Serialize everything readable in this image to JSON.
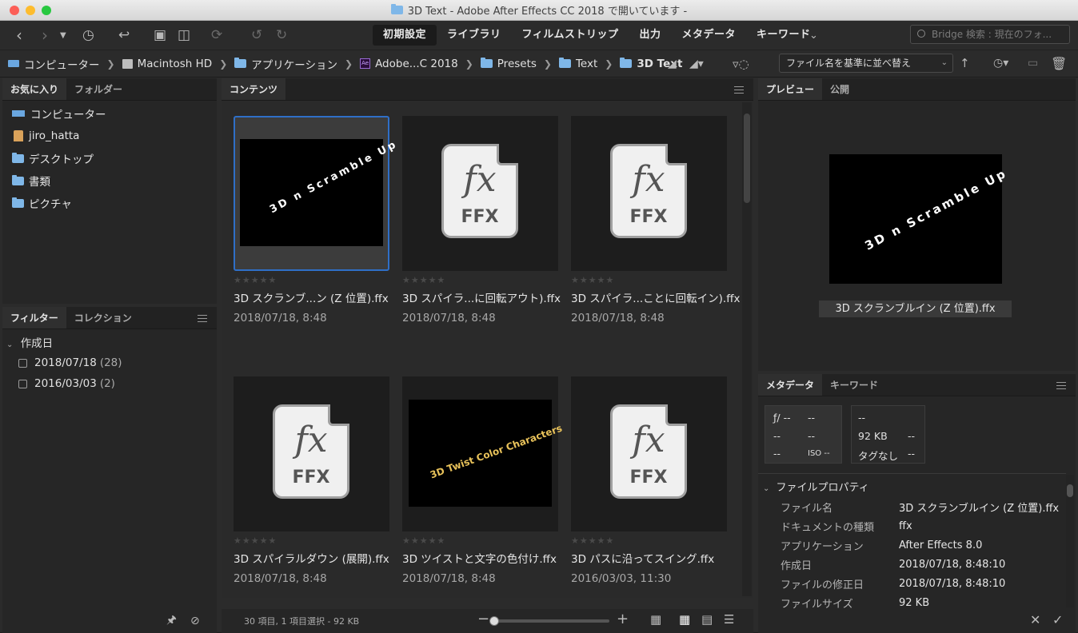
{
  "window": {
    "title": "3D Text - Adobe After Effects CC 2018 で開いています -"
  },
  "workspaces": [
    "初期設定",
    "ライブラリ",
    "フィルムストリップ",
    "出力",
    "メタデータ",
    "キーワード"
  ],
  "search": {
    "placeholder": "Bridge 検索 : 現在のフォ..."
  },
  "breadcrumb": [
    {
      "label": "コンピューター",
      "icon": "computer-icon"
    },
    {
      "label": "Macintosh HD",
      "icon": "disk-icon"
    },
    {
      "label": "アプリケーション",
      "icon": "folder-icon"
    },
    {
      "label": "Adobe...C 2018",
      "icon": "ae-icon"
    },
    {
      "label": "Presets",
      "icon": "folder-icon"
    },
    {
      "label": "Text",
      "icon": "folder-icon"
    },
    {
      "label": "3D Text",
      "icon": "folder-icon"
    }
  ],
  "sort": {
    "label": "ファイル名を基準に並べ替え"
  },
  "left_top": {
    "tabs": [
      "お気に入り",
      "フォルダー"
    ],
    "items": [
      "コンピューター",
      "jiro_hatta",
      "デスクトップ",
      "書類",
      "ピクチャ"
    ]
  },
  "left_bottom": {
    "tabs": [
      "フィルター",
      "コレクション"
    ],
    "group": "作成日",
    "filters": [
      {
        "label": "2018/07/18",
        "count": "(28)"
      },
      {
        "label": "2016/03/03",
        "count": "(2)"
      }
    ]
  },
  "content": {
    "tab": "コンテンツ",
    "status": "30 項目, 1 項目選択 - 92 KB",
    "items": [
      {
        "name": "3D スクランブ...ン (Z 位置).ffx",
        "date": "2018/07/18, 8:48",
        "kind": "preview-scramble"
      },
      {
        "name": "3D スパイラ...に回転アウト).ffx",
        "date": "2018/07/18, 8:48",
        "kind": "ffx"
      },
      {
        "name": "3D スパイラ...ことに回転イン).ffx",
        "date": "2018/07/18, 8:48",
        "kind": "ffx"
      },
      {
        "name": "3D スパイラルダウン (展開).ffx",
        "date": "2018/07/18, 8:48",
        "kind": "ffx"
      },
      {
        "name": "3D ツイストと文字の色付け.ffx",
        "date": "2018/07/18, 8:48",
        "kind": "preview-twist"
      },
      {
        "name": "3D パスに沿ってスイング.ffx",
        "date": "2016/03/03, 11:30",
        "kind": "ffx"
      }
    ],
    "ffx_label": "FFX",
    "fx_label": "fx",
    "scramble_text": "3D n Scramble Up",
    "twist_text": "3D Twist Color Characters"
  },
  "preview": {
    "tabs": [
      "プレビュー",
      "公開"
    ],
    "caption": "3D スクランブルイン (Z 位置).ffx"
  },
  "metadata": {
    "tabs": [
      "メタデータ",
      "キーワード"
    ],
    "box1": [
      "ƒ/ --",
      "--",
      "--",
      "--",
      "--",
      "ISO --"
    ],
    "box2": [
      "--",
      "",
      "92 KB",
      "--",
      "タグなし",
      "--"
    ],
    "section": "ファイルプロパティ",
    "rows": [
      {
        "k": "ファイル名",
        "v": "3D スクランブルイン (Z 位置).ffx"
      },
      {
        "k": "ドキュメントの種類",
        "v": "ffx"
      },
      {
        "k": "アプリケーション",
        "v": "After Effects 8.0"
      },
      {
        "k": "作成日",
        "v": "2018/07/18, 8:48:10"
      },
      {
        "k": "ファイルの修正日",
        "v": "2018/07/18, 8:48:10"
      },
      {
        "k": "ファイルサイズ",
        "v": "92 KB"
      }
    ]
  }
}
